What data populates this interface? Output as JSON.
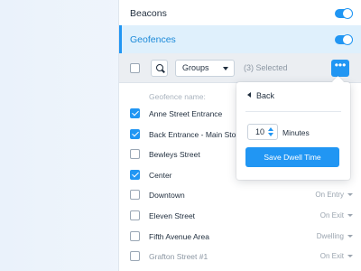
{
  "settings": {
    "beacons": {
      "label": "Beacons",
      "enabled": true
    },
    "geofences": {
      "label": "Geofences",
      "enabled": true
    }
  },
  "toolbar": {
    "groups_label": "Groups",
    "selected_text": "(3) Selected",
    "more_label": "•••"
  },
  "list": {
    "header": "Geofence name:",
    "rows": [
      {
        "name": "Anne Street Entrance",
        "checked": true,
        "trigger": ""
      },
      {
        "name": "Back Entrance - Main Store",
        "checked": true,
        "trigger": ""
      },
      {
        "name": "Bewleys Street",
        "checked": false,
        "trigger": ""
      },
      {
        "name": "Center",
        "checked": true,
        "trigger": ""
      },
      {
        "name": "Downtown",
        "checked": false,
        "trigger": "On Entry"
      },
      {
        "name": "Eleven Street",
        "checked": false,
        "trigger": "On Exit"
      },
      {
        "name": "Fifth Avenue Area",
        "checked": false,
        "trigger": "Dwelling"
      },
      {
        "name": "Grafton Street #1",
        "checked": false,
        "trigger": "On Exit"
      }
    ]
  },
  "popover": {
    "back_label": "Back",
    "minutes_value": "10",
    "minutes_unit": "Minutes",
    "save_label": "Save Dwell Time"
  },
  "colors": {
    "accent": "#2196f3",
    "selected_row_bg": "#dff0fc",
    "text": "#1f2d3d"
  }
}
